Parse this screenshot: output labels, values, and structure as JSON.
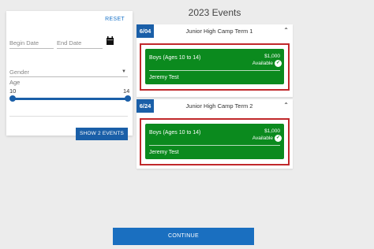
{
  "filters": {
    "reset_label": "RESET",
    "begin_date_placeholder": "Begin Date",
    "end_date_placeholder": "End Date",
    "gender_placeholder": "Gender",
    "age_label": "Age",
    "age_min": "10",
    "age_max": "14",
    "show_button": "SHOW 2 EVENTS"
  },
  "events_title": "2023 Events",
  "events": [
    {
      "date": "6/04",
      "name": "Junior High Camp Term 1",
      "card": {
        "title": "Boys (Ages 10 to 14)",
        "price": "$1,000",
        "availability": "Available",
        "person": "Jeremy Test"
      }
    },
    {
      "date": "6/24",
      "name": "Junior High Camp Term 2",
      "card": {
        "title": "Boys (Ages 10 to 14)",
        "price": "$1,000",
        "availability": "Available",
        "person": "Jeremy Test"
      }
    }
  ],
  "continue_label": "CONTINUE",
  "colors": {
    "primary": "#1a5fa8",
    "card_green": "#0b8a1e",
    "highlight_red": "#c0282b"
  }
}
